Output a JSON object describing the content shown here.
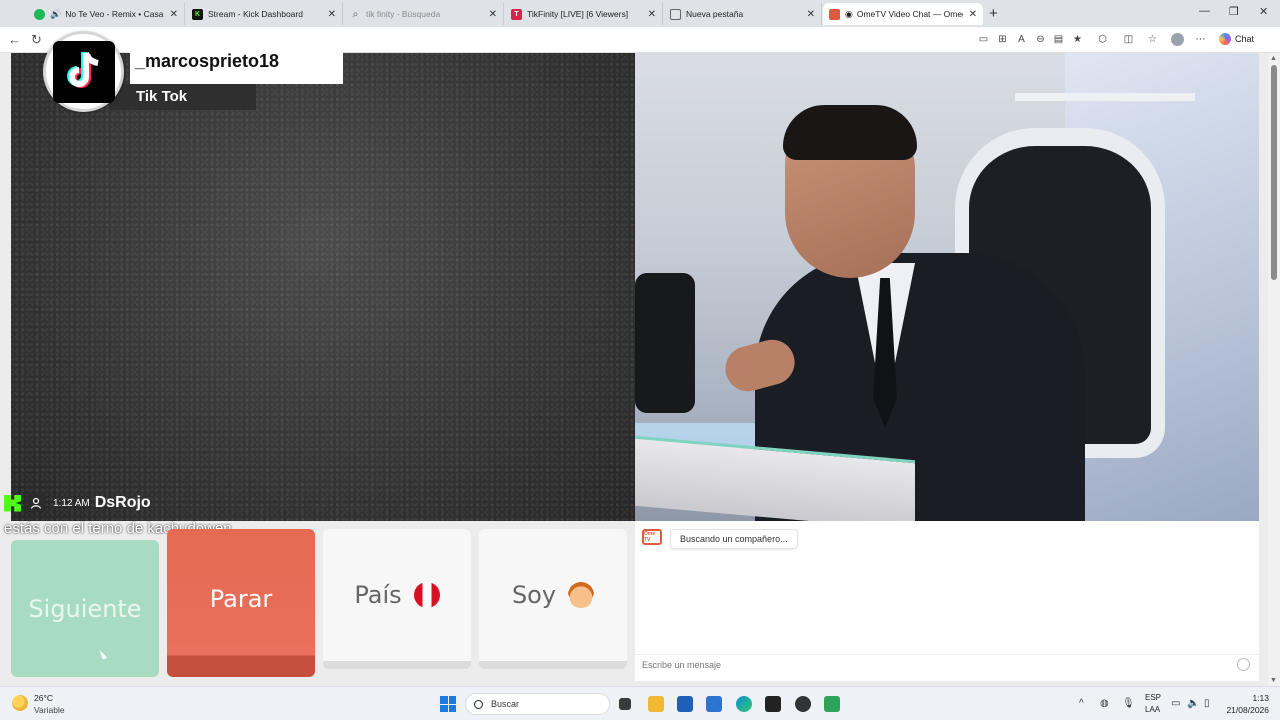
{
  "browser": {
    "tabs": [
      {
        "title": "No Te Veo - Remix • Casa De",
        "favicon": "music-icon",
        "color": "#1db954"
      },
      {
        "title": "Stream - Kick Dashboard",
        "favicon": "kick-icon",
        "color": "#111111"
      },
      {
        "title": "tik finity - Búsqueda",
        "favicon": "search-icon",
        "color": "#999999"
      },
      {
        "title": "TikFinity [LIVE] [6 Viewers]",
        "favicon": "tikfinity-icon",
        "color": "#d4264d"
      },
      {
        "title": "Nueva pestaña",
        "favicon": "newtab-icon",
        "color": "#666666"
      },
      {
        "title": "OmeTV Video Chat — Omeg",
        "favicon": "ometv-icon",
        "color": "#e05a43"
      }
    ],
    "chat_label": "Chat"
  },
  "overlay": {
    "tiktok_username": "_marcosprieto18",
    "tiktok_label": "Tik Tok",
    "kick_time": "1:12 AM",
    "kick_user": "DsRojo",
    "kick_message": "estás con el terno de kachudowen"
  },
  "controls": {
    "next_label": "Siguiente",
    "stop_label": "Parar",
    "country_label": "País",
    "country_flag": "peru-flag-icon",
    "gender_label": "Soy",
    "gender_icon": "boy-emoji-icon"
  },
  "chat": {
    "status": "Buscando un compañero...",
    "input_placeholder": "Escribe un mensaje",
    "logo_text": "Ome TV"
  },
  "taskbar": {
    "temperature": "26°C",
    "weather": "Variable",
    "search_label": "Buscar",
    "lang1": "ESP",
    "lang2": "LAA",
    "time": "1:13",
    "date": "21/08/2026"
  },
  "colors": {
    "next_button": "#a8dcc0",
    "stop_button": "#e76952",
    "kick_green": "#53fc18"
  }
}
